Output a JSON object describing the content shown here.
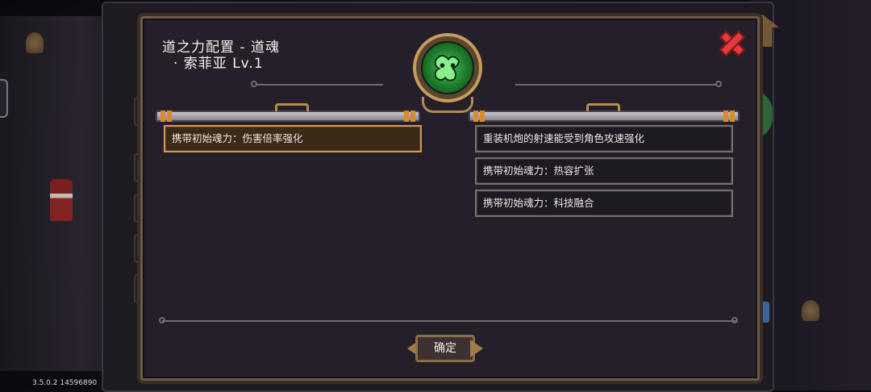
{
  "dialog": {
    "title_line1": "道之力配置 - 道魂",
    "title_line2": "· 索菲亚 Lv.1",
    "confirm_label": "确定"
  },
  "left_column": {
    "items": [
      {
        "label": "携带初始魂力：伤害倍率强化",
        "selected": true
      }
    ]
  },
  "right_column": {
    "items": [
      {
        "label": "重装机炮的射速能受到角色攻速强化"
      },
      {
        "label": "携带初始魂力：热容扩张"
      },
      {
        "label": "携带初始魂力：科技融合"
      }
    ]
  },
  "footer": {
    "version": "3.5.0.2 14596890"
  },
  "colors": {
    "panel_bg": "#251f29",
    "selected_border": "#d39a4e",
    "emblem_green": "#47c45a",
    "close_red": "#e03a3a"
  },
  "icons": [
    "close-icon",
    "soul-emblem-icon"
  ]
}
